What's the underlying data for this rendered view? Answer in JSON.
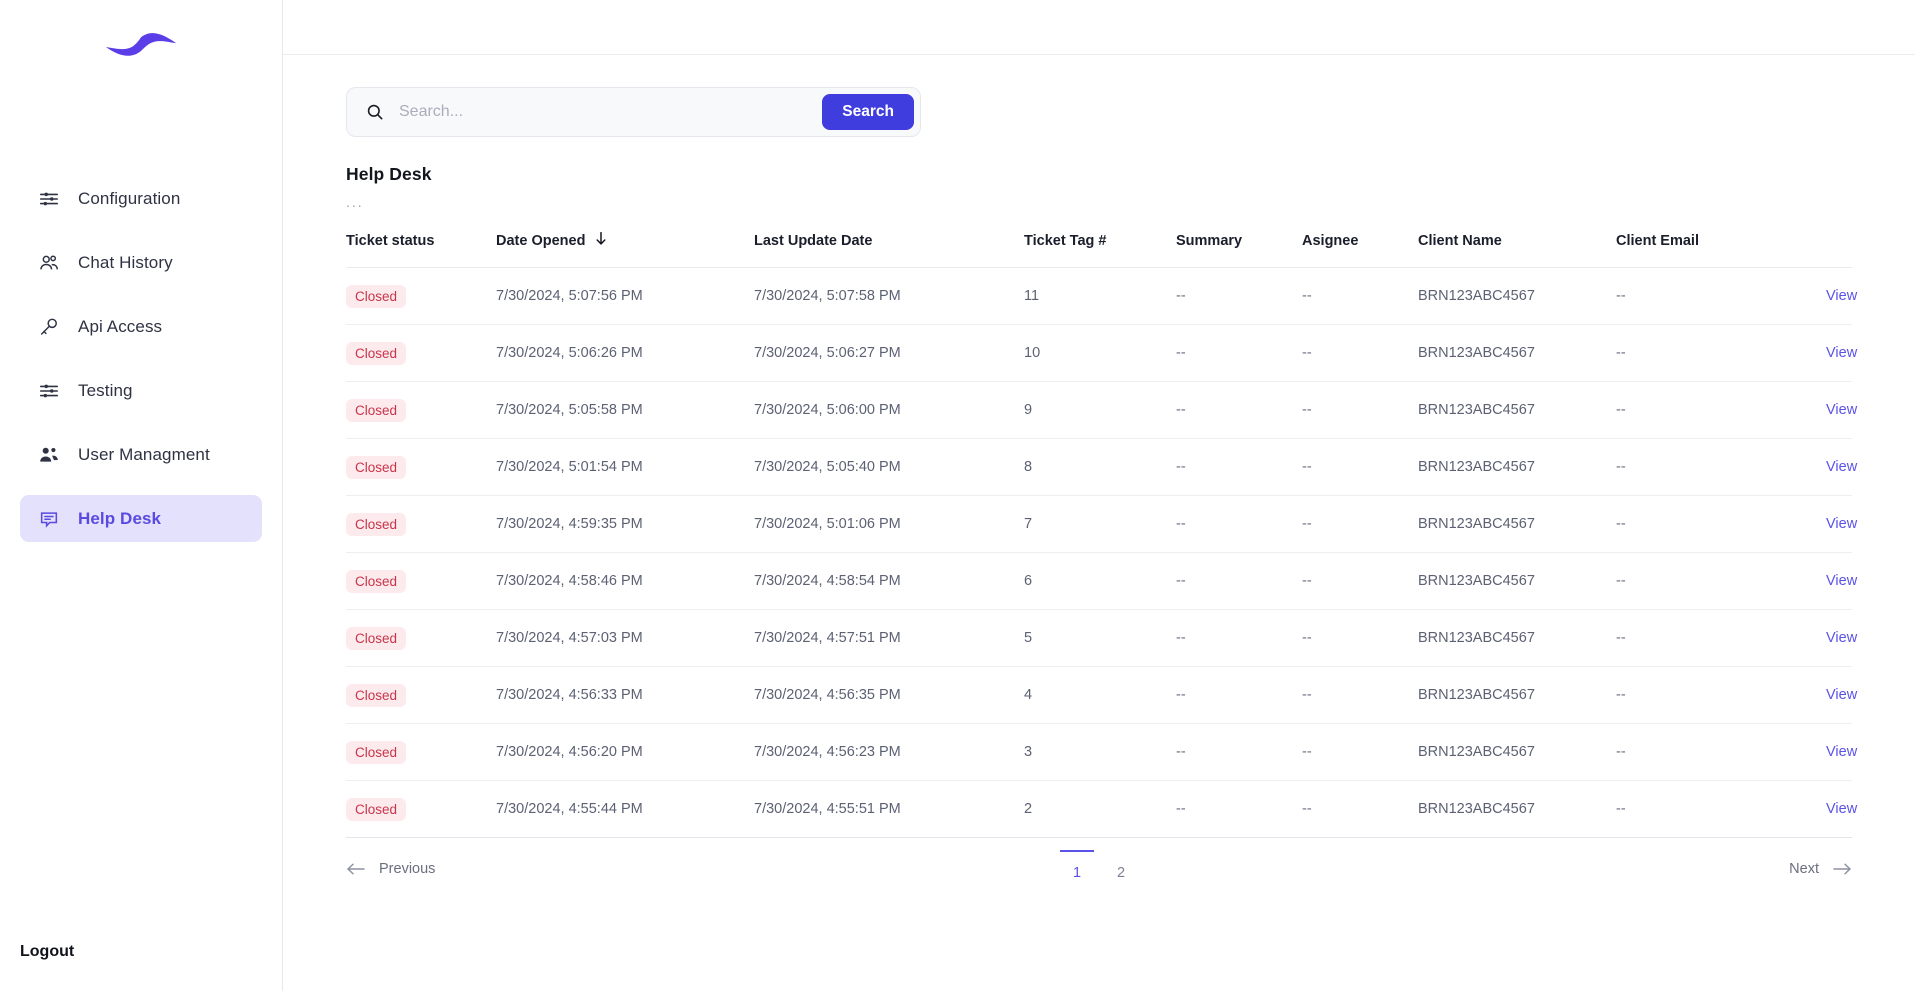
{
  "brand": {
    "logo_icon": "wave-logo-icon",
    "accent": "#5b4ae0"
  },
  "sidebar": {
    "items": [
      {
        "label": "Configuration",
        "icon": "sliders-icon",
        "active": false
      },
      {
        "label": "Chat History",
        "icon": "users-icon",
        "active": false
      },
      {
        "label": "Api Access",
        "icon": "key-icon",
        "active": false
      },
      {
        "label": "Testing",
        "icon": "sliders-icon",
        "active": false
      },
      {
        "label": "User Managment",
        "icon": "users-solid-icon",
        "active": false
      },
      {
        "label": "Help Desk",
        "icon": "chat-bubble-icon",
        "active": true
      }
    ],
    "logout_label": "Logout"
  },
  "search": {
    "placeholder": "Search...",
    "value": "",
    "button_label": "Search",
    "icon": "search-icon"
  },
  "page": {
    "title": "Help Desk",
    "subtitle": "..."
  },
  "table": {
    "columns": [
      "Ticket status",
      "Date Opened",
      "Last Update Date",
      "Ticket Tag #",
      "Summary",
      "Asignee",
      "Client Name",
      "Client Email"
    ],
    "sort_column": "Date Opened",
    "sort_direction": "descending",
    "sort_icon": "arrow-down-icon",
    "action_label": "View",
    "rows": [
      {
        "status": "Closed",
        "date_opened": "7/30/2024, 5:07:56 PM",
        "last_update": "7/30/2024, 5:07:58 PM",
        "tag": "11",
        "summary": "--",
        "assignee": "--",
        "client_name": "BRN123ABC4567",
        "client_email": "--",
        "action": "View"
      },
      {
        "status": "Closed",
        "date_opened": "7/30/2024, 5:06:26 PM",
        "last_update": "7/30/2024, 5:06:27 PM",
        "tag": "10",
        "summary": "--",
        "assignee": "--",
        "client_name": "BRN123ABC4567",
        "client_email": "--",
        "action": "View"
      },
      {
        "status": "Closed",
        "date_opened": "7/30/2024, 5:05:58 PM",
        "last_update": "7/30/2024, 5:06:00 PM",
        "tag": "9",
        "summary": "--",
        "assignee": "--",
        "client_name": "BRN123ABC4567",
        "client_email": "--",
        "action": "View"
      },
      {
        "status": "Closed",
        "date_opened": "7/30/2024, 5:01:54 PM",
        "last_update": "7/30/2024, 5:05:40 PM",
        "tag": "8",
        "summary": "--",
        "assignee": "--",
        "client_name": "BRN123ABC4567",
        "client_email": "--",
        "action": "View"
      },
      {
        "status": "Closed",
        "date_opened": "7/30/2024, 4:59:35 PM",
        "last_update": "7/30/2024, 5:01:06 PM",
        "tag": "7",
        "summary": "--",
        "assignee": "--",
        "client_name": "BRN123ABC4567",
        "client_email": "--",
        "action": "View"
      },
      {
        "status": "Closed",
        "date_opened": "7/30/2024, 4:58:46 PM",
        "last_update": "7/30/2024, 4:58:54 PM",
        "tag": "6",
        "summary": "--",
        "assignee": "--",
        "client_name": "BRN123ABC4567",
        "client_email": "--",
        "action": "View"
      },
      {
        "status": "Closed",
        "date_opened": "7/30/2024, 4:57:03 PM",
        "last_update": "7/30/2024, 4:57:51 PM",
        "tag": "5",
        "summary": "--",
        "assignee": "--",
        "client_name": "BRN123ABC4567",
        "client_email": "--",
        "action": "View"
      },
      {
        "status": "Closed",
        "date_opened": "7/30/2024, 4:56:33 PM",
        "last_update": "7/30/2024, 4:56:35 PM",
        "tag": "4",
        "summary": "--",
        "assignee": "--",
        "client_name": "BRN123ABC4567",
        "client_email": "--",
        "action": "View"
      },
      {
        "status": "Closed",
        "date_opened": "7/30/2024, 4:56:20 PM",
        "last_update": "7/30/2024, 4:56:23 PM",
        "tag": "3",
        "summary": "--",
        "assignee": "--",
        "client_name": "BRN123ABC4567",
        "client_email": "--",
        "action": "View"
      },
      {
        "status": "Closed",
        "date_opened": "7/30/2024, 4:55:44 PM",
        "last_update": "7/30/2024, 4:55:51 PM",
        "tag": "2",
        "summary": "--",
        "assignee": "--",
        "client_name": "BRN123ABC4567",
        "client_email": "--",
        "action": "View"
      }
    ]
  },
  "pagination": {
    "previous_label": "Previous",
    "next_label": "Next",
    "pages": [
      "1",
      "2"
    ],
    "current_page": "1"
  },
  "status_colors": {
    "closed_bg": "#fdeaec",
    "closed_text": "#c8354a"
  }
}
